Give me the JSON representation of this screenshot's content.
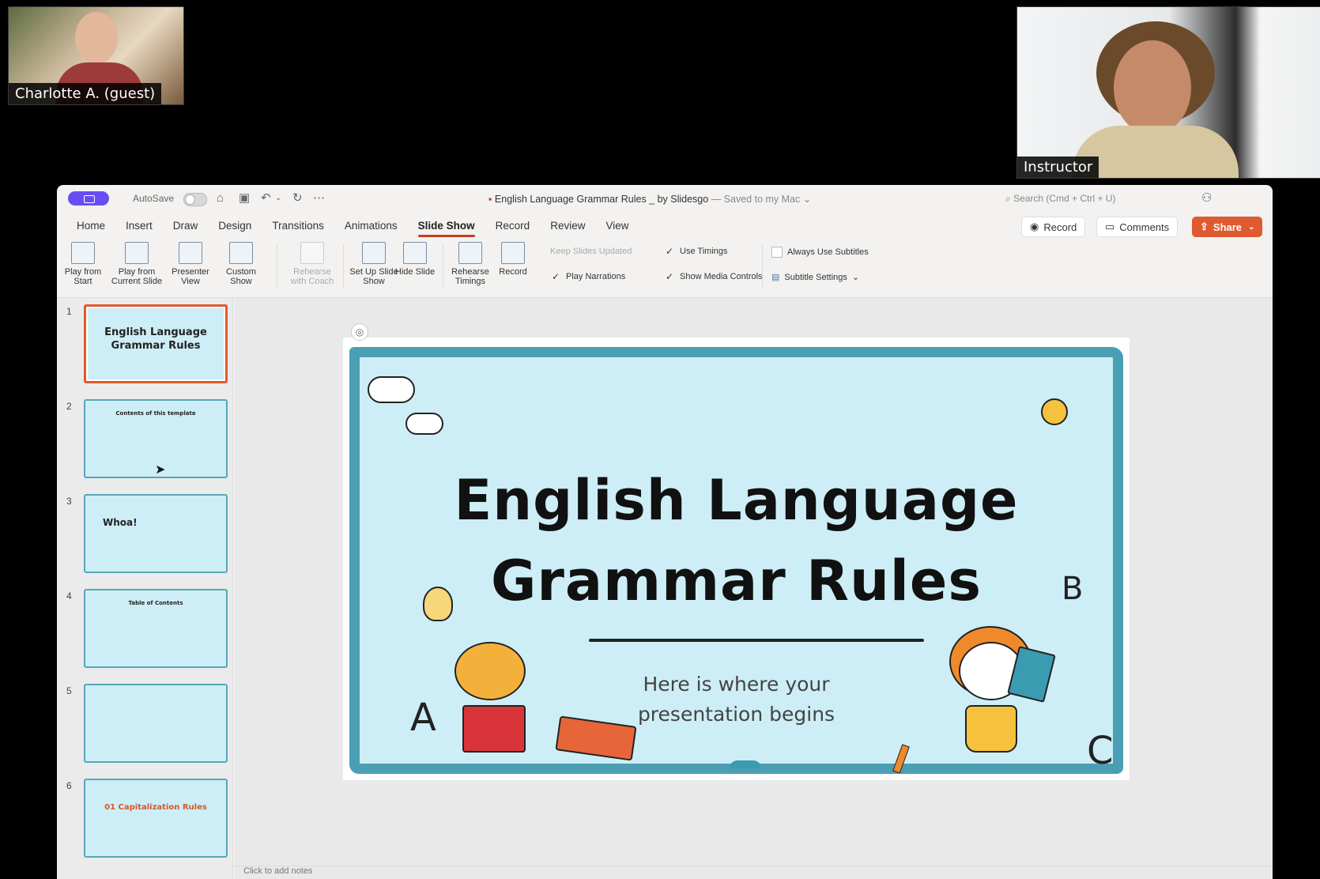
{
  "participants": {
    "guest": {
      "name": "Charlotte A. (guest)"
    },
    "instructor": {
      "name": "Instructor"
    }
  },
  "titlebar": {
    "autosave_label": "AutoSave",
    "doc_title": "English Language Grammar Rules _ by Slidesgo",
    "saved_status": "— Saved to my Mac ⌄",
    "search_placeholder": "Search (Cmd + Ctrl + U)"
  },
  "tabs": [
    "Home",
    "Insert",
    "Draw",
    "Design",
    "Transitions",
    "Animations",
    "Slide Show",
    "Record",
    "Review",
    "View"
  ],
  "active_tab": "Slide Show",
  "actions": {
    "record": "Record",
    "comments": "Comments",
    "share": "Share"
  },
  "ribbon": {
    "play_from_start": "Play from Start",
    "play_from_current": "Play from Current Slide",
    "presenter_view": "Presenter View",
    "custom_show": "Custom Show",
    "rehearse_coach": "Rehearse with Coach",
    "set_up": "Set Up Slide Show",
    "hide_slide": "Hide Slide",
    "rehearse_timings": "Rehearse Timings",
    "record": "Record",
    "keep_updated": "Keep Slides Updated",
    "use_timings": "Use Timings",
    "play_narrations": "Play Narrations",
    "show_media_controls": "Show Media Controls",
    "always_subtitles": "Always Use Subtitles",
    "subtitle_settings": "Subtitle Settings"
  },
  "thumbnails": [
    {
      "num": "1",
      "text": "English Language Grammar Rules"
    },
    {
      "num": "2",
      "text": "Contents of this template"
    },
    {
      "num": "3",
      "text": "Whoa!"
    },
    {
      "num": "4",
      "text": "Table of Contents"
    },
    {
      "num": "5",
      "text": ""
    },
    {
      "num": "6",
      "text": "01 Capitalization Rules"
    }
  ],
  "slide": {
    "title_line1": "English Language",
    "title_line2": "Grammar Rules",
    "subtitle_line1": "Here is where your",
    "subtitle_line2": "presentation begins",
    "letters": [
      "A",
      "B",
      "C"
    ]
  },
  "notes_placeholder": "Click to add notes",
  "colors": {
    "accent": "#c43e1c",
    "share": "#e05a2f",
    "slide_bg": "#cdeef6",
    "slide_border": "#4a9fb5"
  }
}
